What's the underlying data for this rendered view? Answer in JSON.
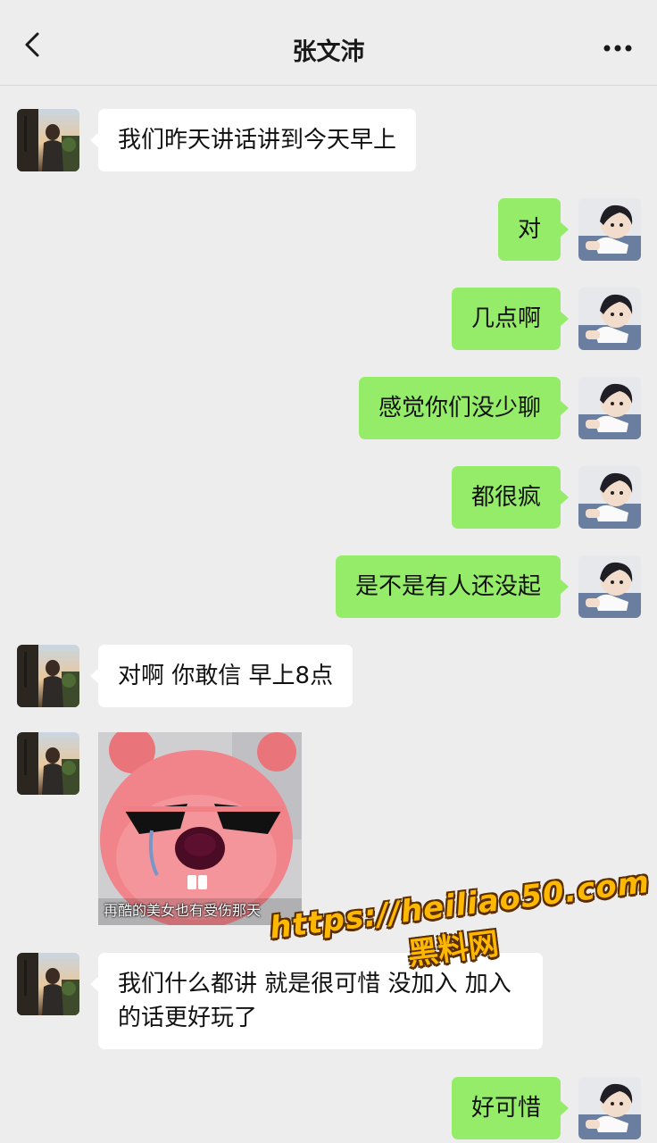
{
  "header": {
    "title": "张文沛",
    "back_icon": "chevron-left-icon",
    "more_icon": "more-dots-icon"
  },
  "colors": {
    "background": "#ededed",
    "incoming_bubble": "#ffffff",
    "outgoing_bubble": "#95ec69",
    "watermark": "#ffb800"
  },
  "messages": [
    {
      "side": "left",
      "type": "text",
      "text": "我们昨天讲话讲到今天早上"
    },
    {
      "side": "right",
      "type": "text",
      "text": "对"
    },
    {
      "side": "right",
      "type": "text",
      "text": "几点啊"
    },
    {
      "side": "right",
      "type": "text",
      "text": "感觉你们没少聊"
    },
    {
      "side": "right",
      "type": "text",
      "text": "都很疯"
    },
    {
      "side": "right",
      "type": "text",
      "text": "是不是有人还没起"
    },
    {
      "side": "left",
      "type": "text",
      "text": "对啊 你敢信 早上8点"
    },
    {
      "side": "left",
      "type": "sticker",
      "caption": "再酷的美女也有受伤那天"
    },
    {
      "side": "left",
      "type": "text",
      "text": "我们什么都讲 就是很可惜 没加入 加入的话更好玩了"
    },
    {
      "side": "right",
      "type": "text",
      "text": "好可惜"
    }
  ],
  "watermark": {
    "url": "https://heiliao50.com",
    "name": "黑料网"
  }
}
